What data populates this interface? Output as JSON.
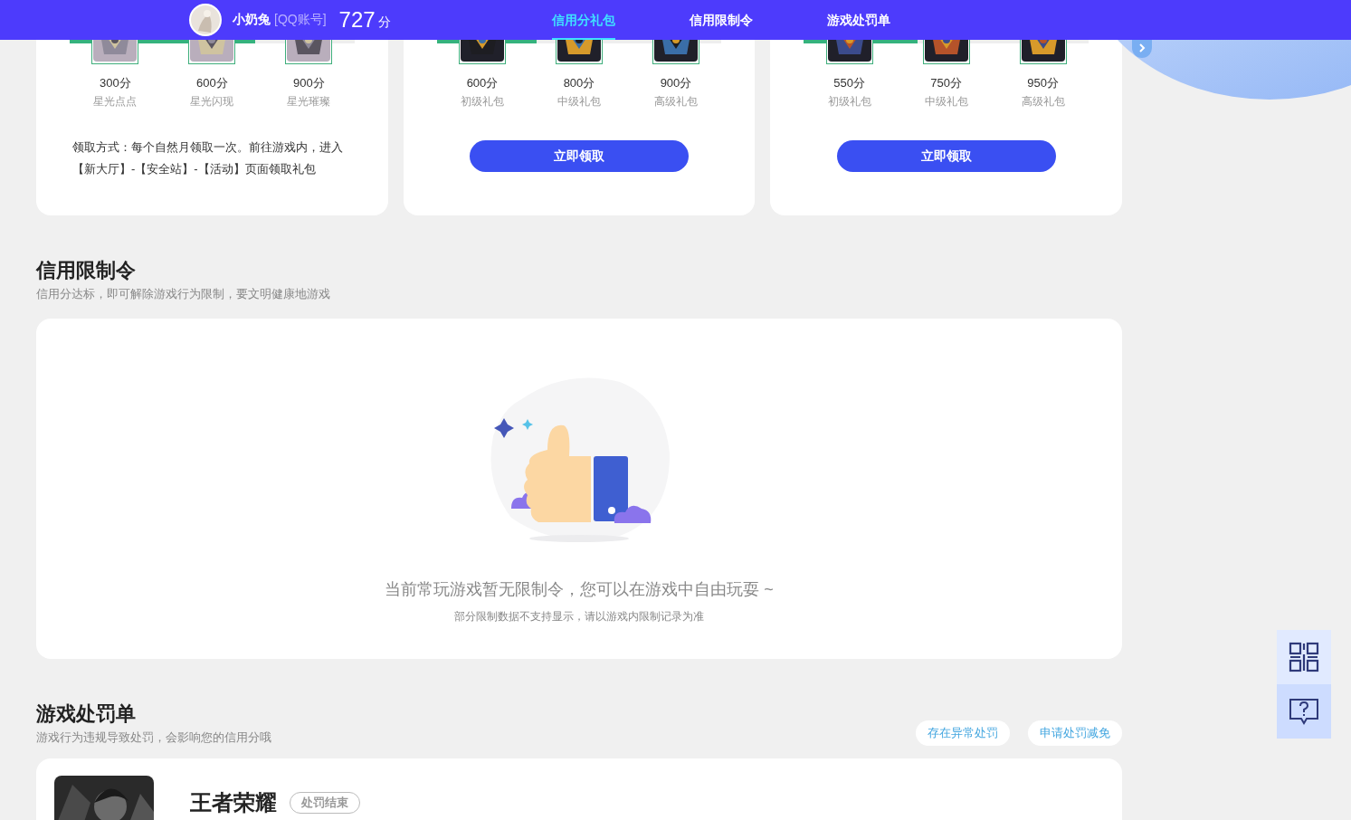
{
  "header": {
    "username": "小奶兔",
    "account": "[QQ账号]",
    "score": "727",
    "score_unit": "分",
    "tabs": [
      {
        "label": "信用分礼包",
        "selected": true
      },
      {
        "label": "信用限制令",
        "selected": false
      },
      {
        "label": "游戏处罚单",
        "selected": false
      }
    ]
  },
  "gift_cards": [
    {
      "level": 0.65,
      "items": [
        {
          "points": "300分",
          "name": "星光点点"
        },
        {
          "points": "600分",
          "name": "星光闪现"
        },
        {
          "points": "900分",
          "name": "星光璀璨"
        }
      ],
      "note": "领取方式：每个自然月领取一次。前往游戏内，进入【新大厅】-【安全站】-【活动】页面领取礼包"
    },
    {
      "level": 0.35,
      "items": [
        {
          "points": "600分",
          "name": "初级礼包"
        },
        {
          "points": "800分",
          "name": "中级礼包"
        },
        {
          "points": "900分",
          "name": "高级礼包"
        }
      ],
      "button": "立即领取"
    },
    {
      "level": 0.4,
      "items": [
        {
          "points": "550分",
          "name": "初级礼包"
        },
        {
          "points": "750分",
          "name": "中级礼包"
        },
        {
          "points": "950分",
          "name": "高级礼包"
        }
      ],
      "button": "立即领取"
    }
  ],
  "restrictions": {
    "title": "信用限制令",
    "subtitle": "信用分达标，即可解除游戏行为限制，要文明健康地游戏",
    "empty_message": "当前常玩游戏暂无限制令，您可以在游戏中自由玩耍 ~",
    "empty_hint": "部分限制数据不支持显示，请以游戏内限制记录为准"
  },
  "penalties": {
    "title": "游戏处罚单",
    "subtitle": "游戏行为违规导致处罚，会影响您的信用分哦",
    "actions": [
      "存在异常处罚",
      "申请处罚减免"
    ],
    "records": [
      {
        "game": "王者荣耀",
        "status": "处罚结束"
      }
    ]
  }
}
